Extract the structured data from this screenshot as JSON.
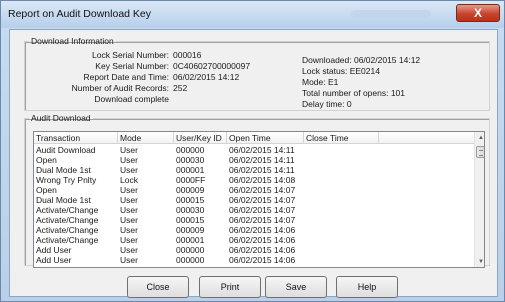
{
  "window": {
    "title": "Report on Audit Download Key",
    "close_glyph": "X"
  },
  "download_info": {
    "legend": "Download Information",
    "left": [
      {
        "label": "Lock Serial Number:",
        "value": "000016"
      },
      {
        "label": "Key Serial Number:",
        "value": "0C40602700000097"
      },
      {
        "label": "Report Date and Time:",
        "value": "06/02/2015 14:12"
      },
      {
        "label": "Number of Audit Records:",
        "value": "252"
      },
      {
        "label": "Download complete",
        "value": ""
      }
    ],
    "right": [
      "Downloaded: 06/02/2015 14:12",
      "Lock status: EE0214",
      "Mode: E1",
      "Total number of opens: 101",
      "Delay time: 0"
    ]
  },
  "audit": {
    "legend": "Audit Download",
    "columns": [
      "Transaction",
      "Mode",
      "User/Key ID",
      "Open Time",
      "Close Time"
    ],
    "rows": [
      [
        "Audit Download",
        "User",
        "000000",
        "06/02/2015 14:11",
        ""
      ],
      [
        "Open",
        "User",
        "000030",
        "06/02/2015 14:11",
        ""
      ],
      [
        "Dual Mode 1st",
        "User",
        "000001",
        "06/02/2015 14:11",
        ""
      ],
      [
        "Wrong Try Pnlty",
        "Lock",
        "0000FF",
        "06/02/2015 14:08",
        ""
      ],
      [
        "Open",
        "User",
        "000009",
        "06/02/2015 14:07",
        ""
      ],
      [
        "Dual Mode 1st",
        "User",
        "000015",
        "06/02/2015 14:07",
        ""
      ],
      [
        "Activate/Change",
        "User",
        "000030",
        "06/02/2015 14:07",
        ""
      ],
      [
        "Activate/Change",
        "User",
        "000015",
        "06/02/2015 14:07",
        ""
      ],
      [
        "Activate/Change",
        "User",
        "000009",
        "06/02/2015 14:06",
        ""
      ],
      [
        "Activate/Change",
        "User",
        "000001",
        "06/02/2015 14:06",
        ""
      ],
      [
        "Add User",
        "User",
        "000000",
        "06/02/2015 14:06",
        ""
      ],
      [
        "Add User",
        "User",
        "000000",
        "06/02/2015 14:06",
        ""
      ]
    ]
  },
  "buttons": {
    "close": "Close",
    "print": "Print",
    "save": "Save",
    "help": "Help"
  }
}
